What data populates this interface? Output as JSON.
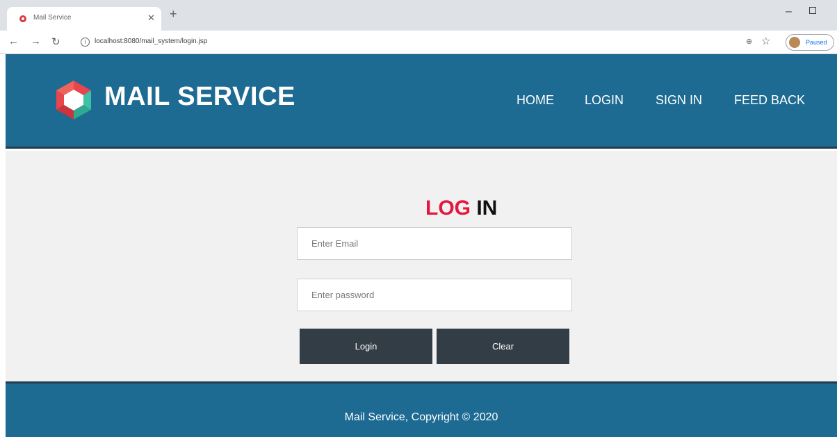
{
  "browser": {
    "tab_title": "Mail Service",
    "url": "localhost:8080/mail_system/login.jsp",
    "profile_label": "Paused",
    "icons": [
      "favicon-icon",
      "close-icon",
      "plus-icon",
      "back-icon",
      "forward-icon",
      "reload-icon",
      "info-icon",
      "zoom-icon",
      "star-icon",
      "minimize-icon",
      "maximize-icon"
    ]
  },
  "header": {
    "brand": "MAIL SERVICE",
    "nav": {
      "home": "HOME",
      "login": "LOGIN",
      "sign_in": "SIGN IN",
      "feedback": "FEED BACK"
    }
  },
  "form": {
    "title_red": "LOG",
    "title_black": "IN",
    "email_placeholder": "Enter Email",
    "password_placeholder": "Enter password",
    "login_button": "Login",
    "clear_button": "Clear"
  },
  "footer": {
    "text": "Mail Service, Copyright © 2020"
  },
  "colors": {
    "header_bg": "#1d6a92",
    "border_dark": "#213d50",
    "main_bg": "#f1f1f1",
    "title_red": "#e5173f",
    "button_bg": "#333d46"
  }
}
